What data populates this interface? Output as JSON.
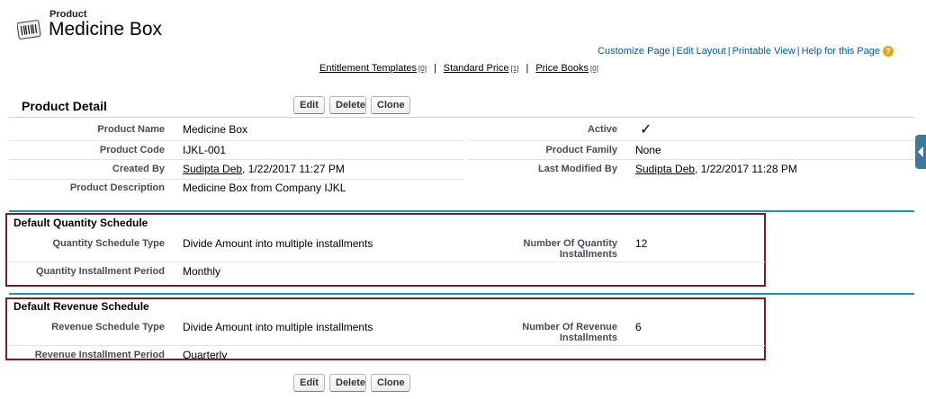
{
  "header": {
    "object_type": "Product",
    "record_name": "Medicine Box"
  },
  "top_links": {
    "customize": "Customize Page",
    "edit_layout": "Edit Layout",
    "printable": "Printable View",
    "help": "Help for this Page",
    "sep": "|",
    "help_icon": "?"
  },
  "related_links": [
    {
      "label": "Entitlement Templates",
      "count": "[0]"
    },
    {
      "label": "Standard Price",
      "count": "[1]"
    },
    {
      "label": "Price Books",
      "count": "[0]"
    }
  ],
  "related_sep": "|",
  "buttons": {
    "edit": "Edit",
    "delete": "Delete",
    "clone": "Clone"
  },
  "detail": {
    "title": "Product Detail",
    "product_name_label": "Product Name",
    "product_name": "Medicine Box",
    "active_label": "Active",
    "active_value": "✓",
    "product_code_label": "Product Code",
    "product_code": "IJKL-001",
    "product_family_label": "Product Family",
    "product_family": "None",
    "created_by_label": "Created By",
    "created_by_user": "Sudipta Deb",
    "created_by_date": ", 1/22/2017 11:27 PM",
    "modified_by_label": "Last Modified By",
    "modified_by_user": "Sudipta Deb",
    "modified_by_date": ", 1/22/2017 11:28 PM",
    "description_label": "Product Description",
    "description": "Medicine Box from Company IJKL"
  },
  "quantity": {
    "title": "Default Quantity Schedule",
    "type_label": "Quantity Schedule Type",
    "type": "Divide Amount into multiple installments",
    "num_label_1": "Number Of Quantity",
    "num_label_2": "Installments",
    "num": "12",
    "period_label": "Quantity Installment Period",
    "period": "Monthly"
  },
  "revenue": {
    "title": "Default Revenue Schedule",
    "type_label": "Revenue Schedule Type",
    "type": "Divide Amount into multiple installments",
    "num_label_1": "Number Of Revenue",
    "num_label_2": "Installments",
    "num": "6",
    "period_label": "Revenue Installment Period",
    "period": "Quarterly"
  }
}
